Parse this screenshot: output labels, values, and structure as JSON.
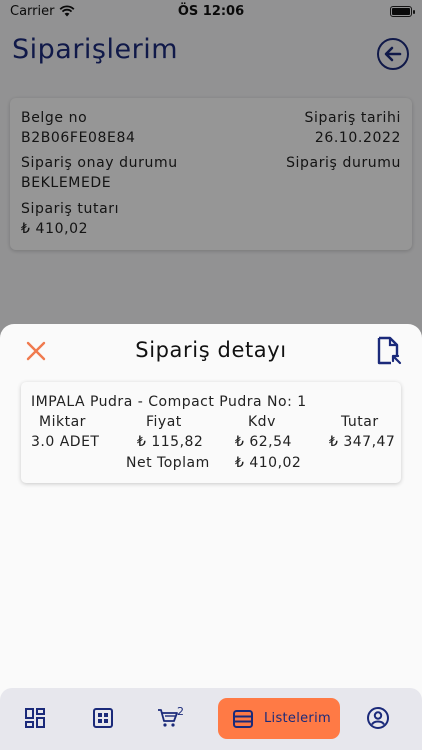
{
  "status_bar": {
    "carrier": "Carrier",
    "time": "ÖS 12:06"
  },
  "header": {
    "title": "Siparişlerim"
  },
  "order": {
    "document_no_label": "Belge no",
    "document_no": "B2B06FE08E84",
    "order_date_label": "Sipariş tarihi",
    "order_date": "26.10.2022",
    "approval_status_label": "Sipariş onay durumu",
    "approval_status": "BEKLEMEDE",
    "order_status_label": "Sipariş durumu",
    "order_total_label": "Sipariş tutarı",
    "order_total": "₺ 410,02"
  },
  "sheet": {
    "title": "Sipariş detayı",
    "item": {
      "name": "IMPALA Pudra  - Compact Pudra No: 1",
      "quantity_label": "Miktar",
      "quantity": "3.0 ADET",
      "price_label": "Fiyat",
      "price": "₺ 115,82",
      "vat_label": "Kdv",
      "vat": "₺ 62,54",
      "total_label": "Tutar",
      "total": "₺ 347,47",
      "net_total_label": "Net Toplam",
      "net_total": "₺ 410,02"
    }
  },
  "bottom_nav": {
    "cart_badge": "2",
    "active_label": "Listelerim",
    "accent_color": "#ff7a45",
    "icon_color": "#1b2a7a",
    "items": [
      "dashboard-icon",
      "grid-icon",
      "cart-icon",
      "list-icon",
      "profile-icon"
    ]
  }
}
